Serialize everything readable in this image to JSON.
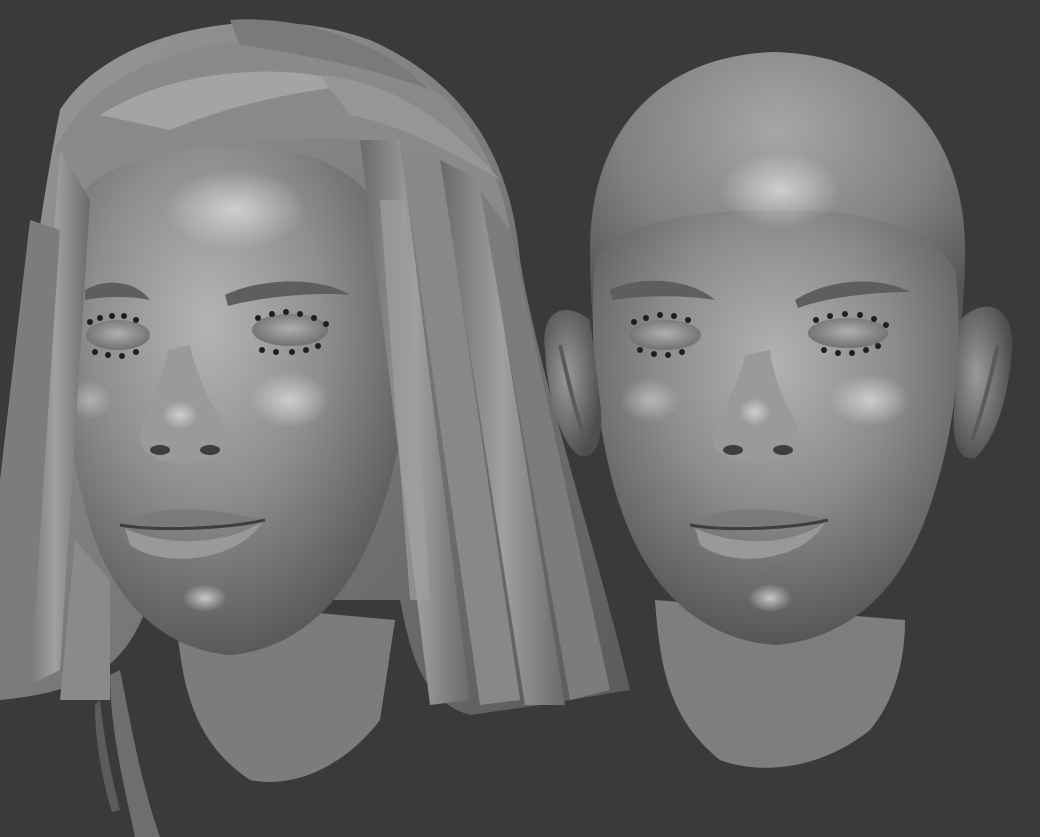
{
  "scene": {
    "background_color": "#3a3a3a",
    "clay_color": "#8a8a8a",
    "models": [
      {
        "name": "head-with-hair",
        "has_hair": true,
        "has_ears_visible": false
      },
      {
        "name": "bald-head",
        "has_hair": false,
        "has_ears_visible": true
      }
    ]
  }
}
